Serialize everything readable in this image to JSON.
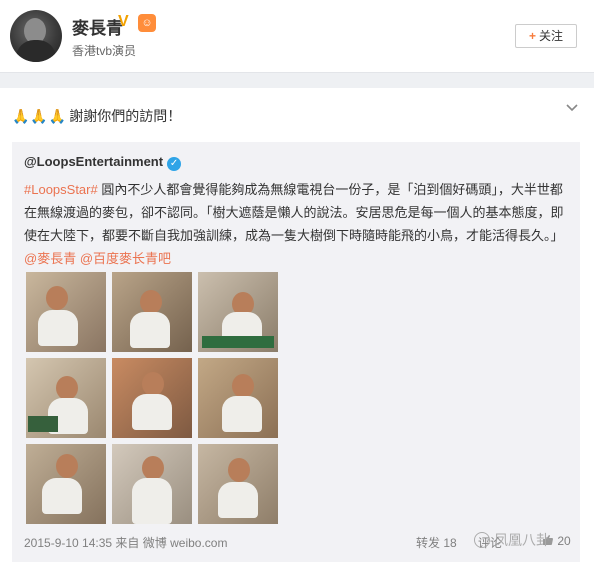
{
  "header": {
    "username": "麥長青",
    "verified_mark": "V",
    "level_badge": "☺",
    "bio": "香港tvb演员",
    "follow_button": {
      "plus": "+",
      "label": "关注"
    }
  },
  "post": {
    "reaction": "🙏🙏🙏",
    "text": "謝謝你們的訪問！",
    "menu_icon": "chevron-down-icon",
    "repost": {
      "author": "@LoopsEntertainment",
      "verified_mark": "✓",
      "hashtag": "#LoopsStar#",
      "body": " 圓內不少人都會覺得能夠成為無線電視台一份子，是「泊到個好碼頭」，大半世都在無線渡過的麥包，卻不認同。「樹大遮蔭是懶人的說法。安居思危是每一個人的基本態度，即使在大陸下，都要不斷自我加強訓練，成為一隻大樹倒下時隨時能飛的小鳥，才能活得長久。」",
      "mention1": "@麥長青",
      "mention2": "@百度麥长青吧",
      "photos_count": 9,
      "time": "2015-9-10 14:35",
      "source_prefix": "来自",
      "source": "微博 weibo.com",
      "repost_label": "转发 18",
      "comment_label": "评论",
      "like_count": "20"
    }
  },
  "watermark": {
    "text": "凤凰八卦"
  },
  "colors": {
    "link": "#eb7350",
    "accent": "#f77c3d",
    "verify_blue": "#2fa4e7",
    "repost_bg": "#f2f2f5"
  }
}
